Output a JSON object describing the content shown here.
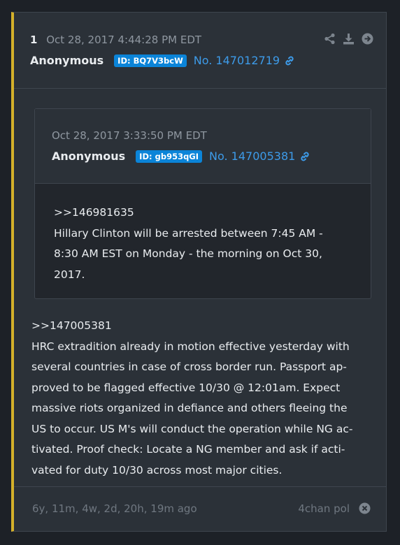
{
  "post": {
    "number": "1",
    "date": "Oct 28, 2017 4:44:28 PM EDT",
    "author": "Anonymous",
    "id_badge": "ID: BQ7V3bcW",
    "post_no": "No. 147012719",
    "actions": [
      "share-icon",
      "download-icon",
      "arrow-right-circle-icon"
    ],
    "quote": {
      "date": "Oct 28, 2017 3:33:50 PM EDT",
      "author": "Anonymous",
      "id_badge": "ID: gb953qGI",
      "post_no": "No. 147005381",
      "body": ">>146981635\nHillary Clinton will be arrested between 7:45 AM -\n8:30 AM EST on Monday - the morning on Oct 30,\n2017."
    },
    "body": ">>147005381\nHRC extradition already in motion effective yesterday with\nseveral countries in case of cross border run. Passport ap-\nproved to be flagged effective 10/30 @ 12:01am. Expect\nmassive riots organized in defiance and others fleeing the\nUS to occur. US M's will conduct the operation while NG ac-\ntivated. Proof check: Locate a NG member and ask if acti-\nvated for duty 10/30 across most major cities.",
    "footer": {
      "ago": "6y, 11m, 4w, 2d, 20h, 19m ago",
      "source": "4chan pol"
    }
  },
  "colors": {
    "accent_border": "#d4b02a",
    "badge_bg": "#0b84d8",
    "link": "#3d9be9",
    "card_bg": "#2b3138"
  }
}
